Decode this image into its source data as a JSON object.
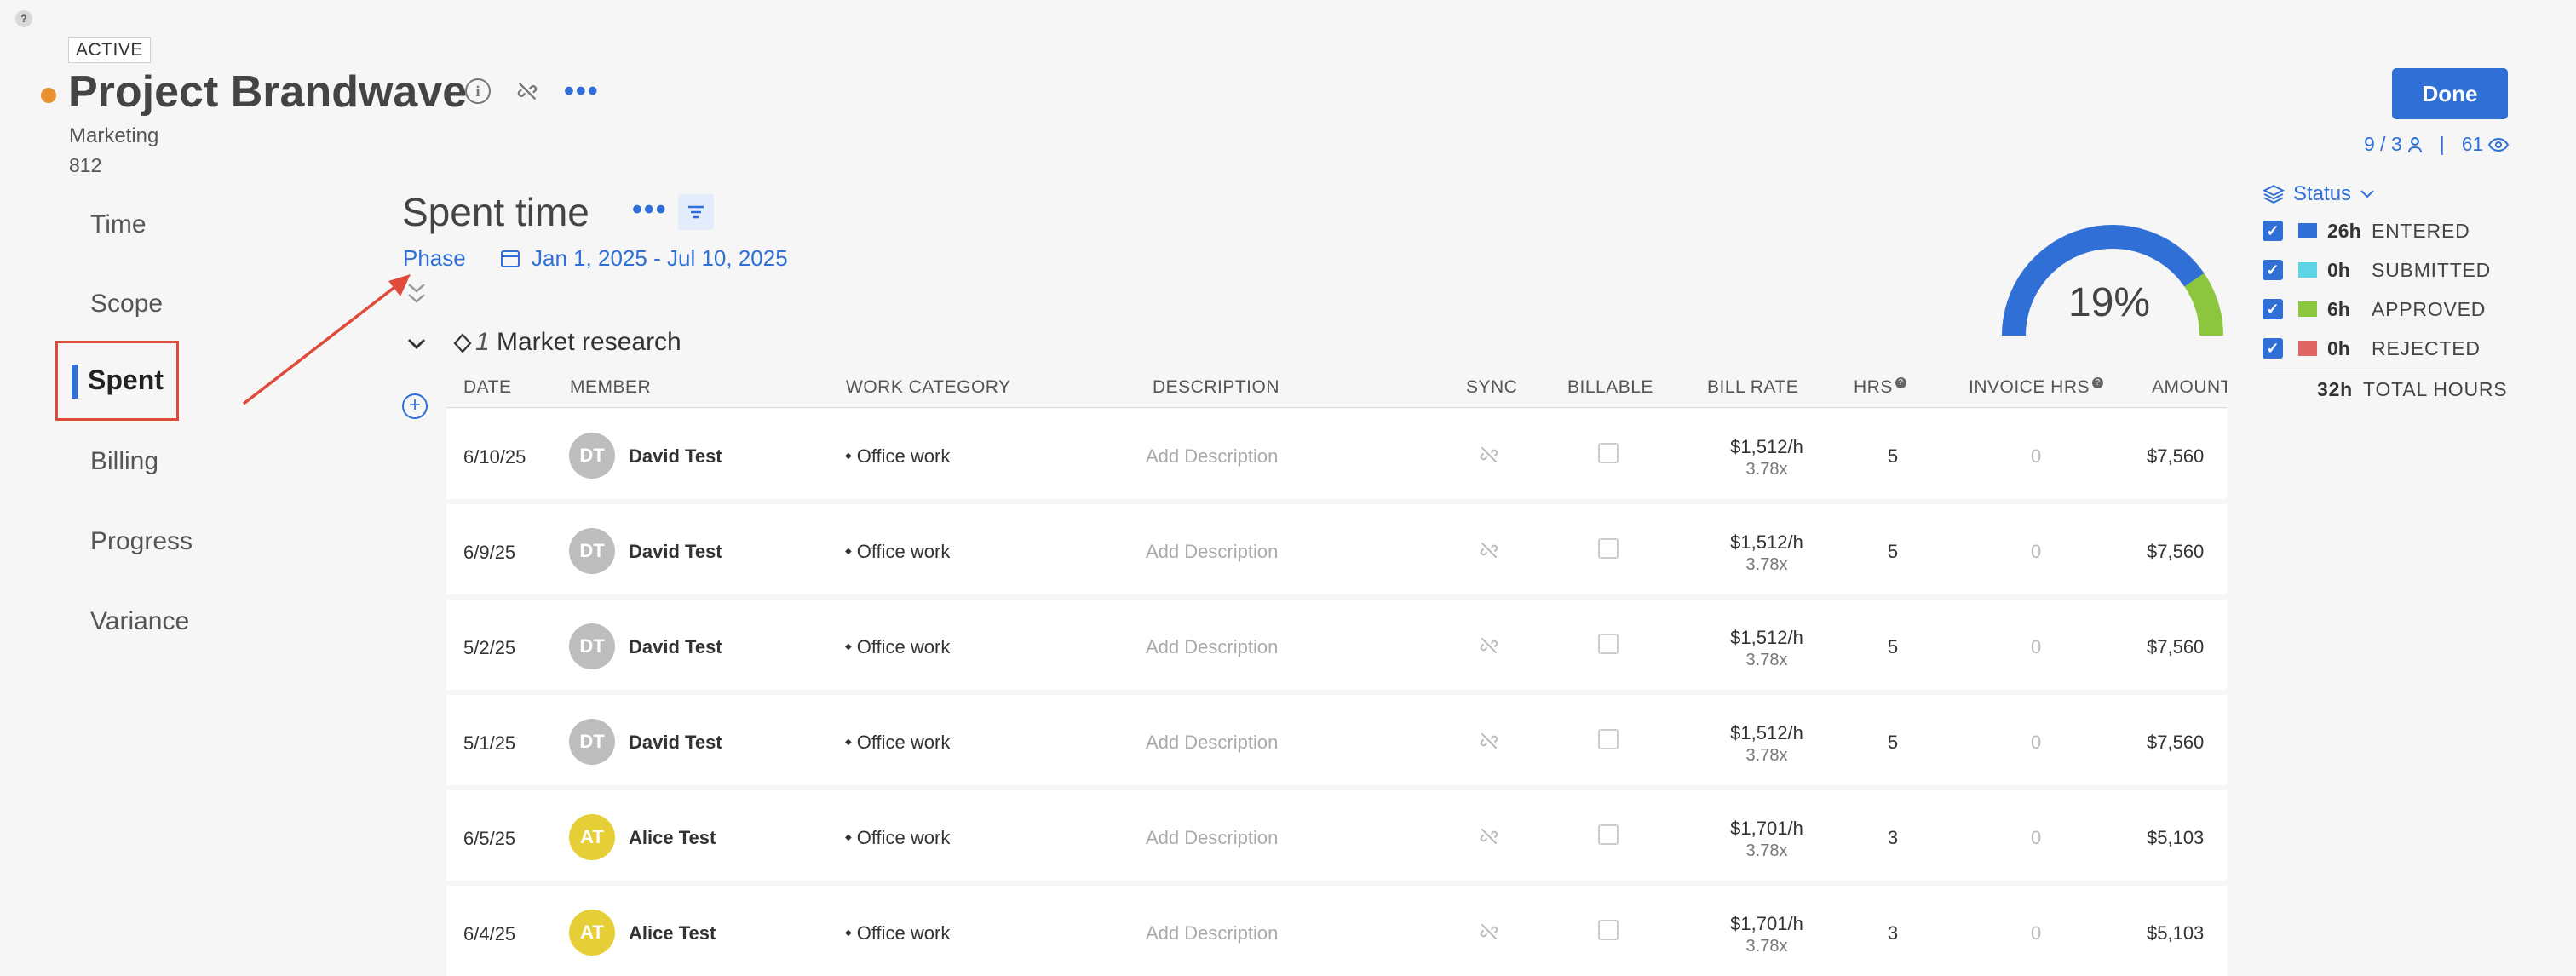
{
  "help_badge": "?",
  "project": {
    "status": "ACTIVE",
    "status_color": "#e8912e",
    "title": "Project Brandwave",
    "subtitle": "Marketing",
    "number": "812"
  },
  "nav": {
    "items": [
      "Time",
      "Scope",
      "Spent",
      "Billing",
      "Progress",
      "Variance"
    ],
    "active": "Spent"
  },
  "main": {
    "title": "Spent time",
    "group_by": "Phase",
    "date_range": "Jan 1, 2025 - Jul 10, 2025",
    "phase": {
      "number": "1",
      "name": "Market research"
    }
  },
  "table": {
    "headers": {
      "date": "DATE",
      "member": "MEMBER",
      "work_category": "WORK CATEGORY",
      "description": "DESCRIPTION",
      "sync": "SYNC",
      "billable": "BILLABLE",
      "bill_rate": "BILL RATE",
      "hrs": "HRS",
      "invoice_hrs": "INVOICE HRS",
      "amount": "AMOUNT"
    },
    "help_mark": "?",
    "rows": [
      {
        "date": "6/10/25",
        "initials": "DT",
        "avatar_color": "#bdbdbd",
        "member": "David Test",
        "category": "Office work",
        "description": "Add Description",
        "rate": "$1,512/h",
        "multiplier": "3.78x",
        "hrs": "5",
        "invoice_hrs": "0",
        "amount": "$7,560"
      },
      {
        "date": "6/9/25",
        "initials": "DT",
        "avatar_color": "#bdbdbd",
        "member": "David Test",
        "category": "Office work",
        "description": "Add Description",
        "rate": "$1,512/h",
        "multiplier": "3.78x",
        "hrs": "5",
        "invoice_hrs": "0",
        "amount": "$7,560"
      },
      {
        "date": "5/2/25",
        "initials": "DT",
        "avatar_color": "#bdbdbd",
        "member": "David Test",
        "category": "Office work",
        "description": "Add Description",
        "rate": "$1,512/h",
        "multiplier": "3.78x",
        "hrs": "5",
        "invoice_hrs": "0",
        "amount": "$7,560"
      },
      {
        "date": "5/1/25",
        "initials": "DT",
        "avatar_color": "#bdbdbd",
        "member": "David Test",
        "category": "Office work",
        "description": "Add Description",
        "rate": "$1,512/h",
        "multiplier": "3.78x",
        "hrs": "5",
        "invoice_hrs": "0",
        "amount": "$7,560"
      },
      {
        "date": "6/5/25",
        "initials": "AT",
        "avatar_color": "#e6cf36",
        "member": "Alice Test",
        "category": "Office work",
        "description": "Add Description",
        "rate": "$1,701/h",
        "multiplier": "3.78x",
        "hrs": "3",
        "invoice_hrs": "0",
        "amount": "$5,103"
      },
      {
        "date": "6/4/25",
        "initials": "AT",
        "avatar_color": "#e6cf36",
        "member": "Alice Test",
        "category": "Office work",
        "description": "Add Description",
        "rate": "$1,701/h",
        "multiplier": "3.78x",
        "hrs": "3",
        "invoice_hrs": "0",
        "amount": "$5,103"
      }
    ]
  },
  "gauge": {
    "label": "19%",
    "approved_fraction": 0.19,
    "entered_color": "#2f6fd6",
    "approved_color": "#8cc63f"
  },
  "header_right": {
    "done_label": "Done",
    "members": "9 / 3",
    "views": "61"
  },
  "legend": {
    "title": "Status",
    "items": [
      {
        "hours": "26h",
        "label": "ENTERED",
        "color": "#2f6fd6"
      },
      {
        "hours": "0h",
        "label": "SUBMITTED",
        "color": "#5fd3e6"
      },
      {
        "hours": "6h",
        "label": "APPROVED",
        "color": "#8cc63f"
      },
      {
        "hours": "0h",
        "label": "REJECTED",
        "color": "#e06666"
      }
    ],
    "total_hours": "32h",
    "total_label": "TOTAL HOURS"
  }
}
